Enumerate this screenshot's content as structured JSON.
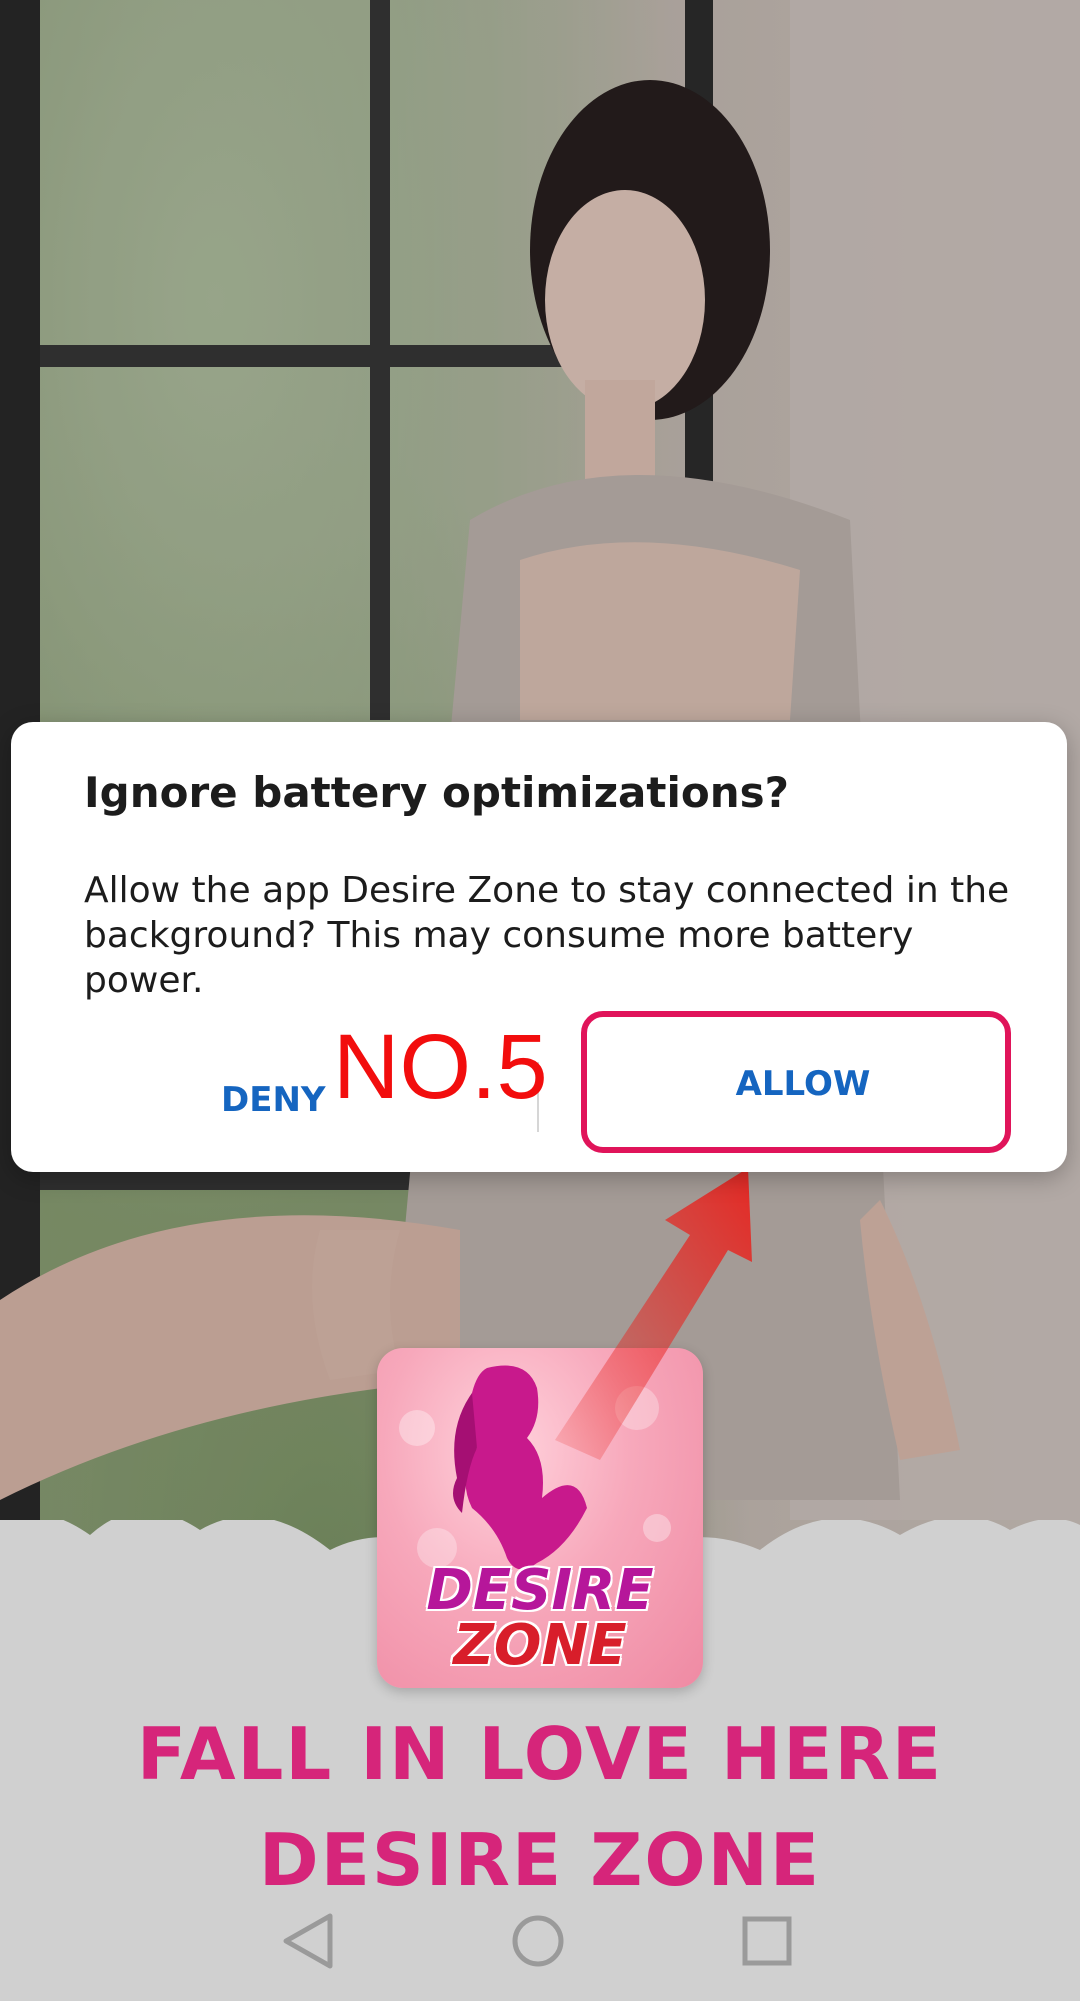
{
  "dialog": {
    "title": "Ignore battery optimizations?",
    "message": "Allow the app Desire Zone to stay connected in the background? This may consume more battery power.",
    "deny_label": "DENY",
    "allow_label": "ALLOW"
  },
  "overlay": {
    "step_label": "NO.5",
    "highlight_color": "#e0145a",
    "arrow_color": "#e8231e"
  },
  "app_icon": {
    "word1": "DESIRE",
    "word2": "ZONE"
  },
  "promo": {
    "line1": "FALL IN LOVE HERE",
    "line2": "DESIRE ZONE",
    "color": "#d6257a"
  },
  "nav": {
    "back_icon": "triangle-back-icon",
    "home_icon": "circle-home-icon",
    "recent_icon": "square-recent-icon"
  },
  "colors": {
    "button_text": "#1565c0",
    "dialog_bg": "#ffffff"
  }
}
